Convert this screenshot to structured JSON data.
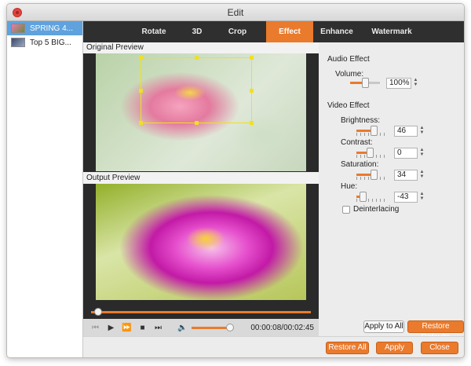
{
  "window": {
    "title": "Edit"
  },
  "sidebar": {
    "items": [
      {
        "label": "SPRING 4...",
        "selected": true
      },
      {
        "label": "Top 5 BIG...",
        "selected": false
      }
    ]
  },
  "tabs": [
    "Rotate",
    "3D",
    "Crop",
    "Effect",
    "Enhance",
    "Watermark"
  ],
  "active_tab": "Effect",
  "preview": {
    "original_label": "Original Preview",
    "output_label": "Output Preview",
    "timecode": "00:00:08/00:02:45"
  },
  "audio": {
    "section_title": "Audio Effect",
    "volume_label": "Volume:",
    "volume_value": "100%"
  },
  "video": {
    "section_title": "Video Effect",
    "brightness_label": "Brightness:",
    "brightness_value": "46",
    "contrast_label": "Contrast:",
    "contrast_value": "0",
    "saturation_label": "Saturation:",
    "saturation_value": "34",
    "hue_label": "Hue:",
    "hue_value": "-43",
    "deinterlacing_label": "Deinterlacing"
  },
  "buttons": {
    "apply_to_all": "Apply to All",
    "restore_defaults": "Restore Defaults",
    "restore_all": "Restore All",
    "apply": "Apply",
    "close": "Close"
  },
  "colors": {
    "accent": "#ea7a2c",
    "tabbar": "#2f2f2f",
    "selection": "#5fa2dd"
  },
  "icons": {
    "controls": [
      "skip-back-icon",
      "play-icon",
      "fast-forward-icon",
      "stop-icon",
      "skip-forward-icon",
      "volume-icon"
    ]
  }
}
